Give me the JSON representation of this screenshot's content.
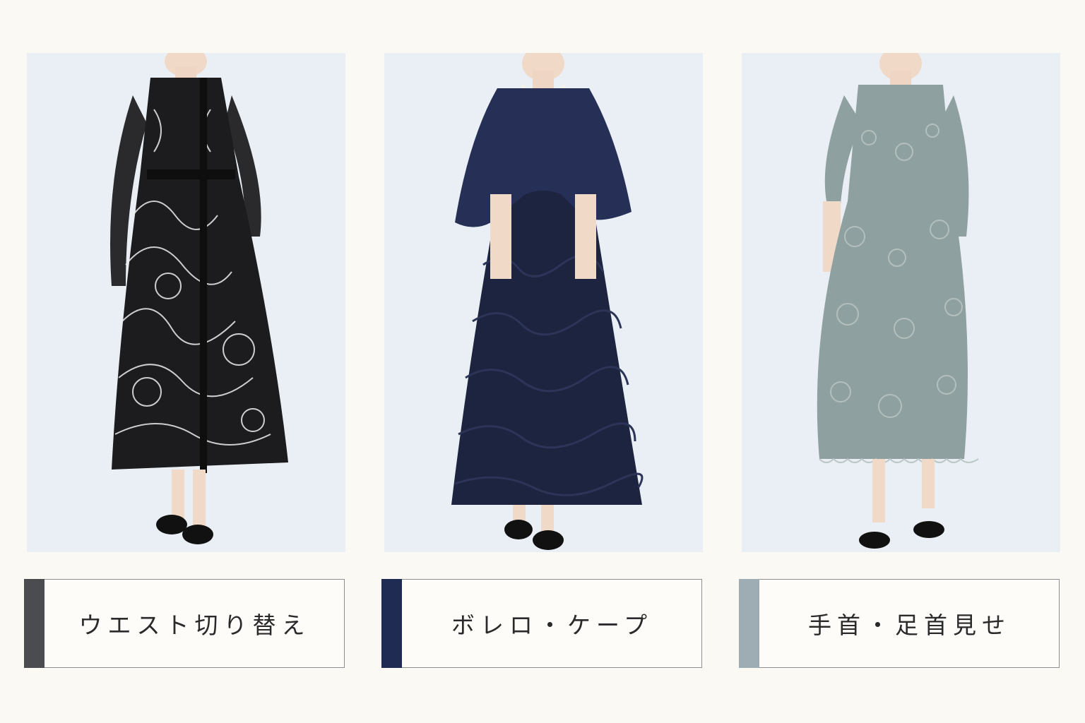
{
  "cards": [
    {
      "label": "ウエスト切り替え",
      "accent_color": "#4a4c50",
      "dress_color": "#1c1c1e",
      "pattern_color": "#ececec",
      "photo_bg": "#e9eff4"
    },
    {
      "label": "ボレロ・ケープ",
      "accent_color": "#1f2b52",
      "dress_color": "#1d2440",
      "pattern_color": "#2c3558",
      "photo_bg": "#e9eff4"
    },
    {
      "label": "手首・足首見せ",
      "accent_color": "#9eacb3",
      "dress_color": "#8fa0a0",
      "pattern_color": "#b6c3c1",
      "photo_bg": "#e9eff4"
    }
  ]
}
